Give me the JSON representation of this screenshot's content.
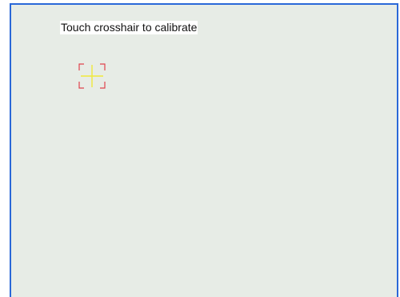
{
  "calibration": {
    "instruction": "Touch crosshair to calibrate",
    "crosshair_icon": "crosshair-target-icon",
    "colors": {
      "background": "#e7ece6",
      "frame": "#2a68d8",
      "bracket": "#e0434d",
      "crosshair": "#f0ea3a"
    }
  }
}
